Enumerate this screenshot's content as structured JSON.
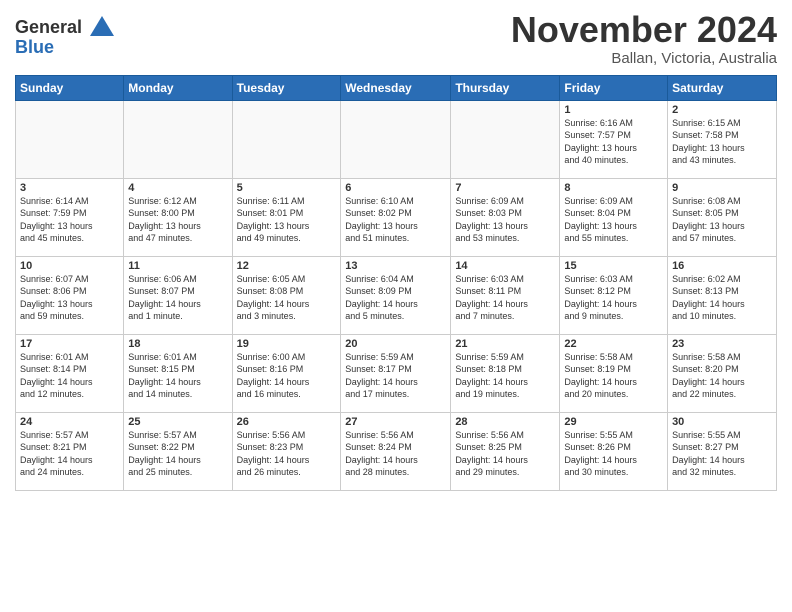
{
  "logo": {
    "line1": "General",
    "line2": "Blue"
  },
  "title": "November 2024",
  "location": "Ballan, Victoria, Australia",
  "days_of_week": [
    "Sunday",
    "Monday",
    "Tuesday",
    "Wednesday",
    "Thursday",
    "Friday",
    "Saturday"
  ],
  "weeks": [
    [
      {
        "day": "",
        "info": ""
      },
      {
        "day": "",
        "info": ""
      },
      {
        "day": "",
        "info": ""
      },
      {
        "day": "",
        "info": ""
      },
      {
        "day": "",
        "info": ""
      },
      {
        "day": "1",
        "info": "Sunrise: 6:16 AM\nSunset: 7:57 PM\nDaylight: 13 hours\nand 40 minutes."
      },
      {
        "day": "2",
        "info": "Sunrise: 6:15 AM\nSunset: 7:58 PM\nDaylight: 13 hours\nand 43 minutes."
      }
    ],
    [
      {
        "day": "3",
        "info": "Sunrise: 6:14 AM\nSunset: 7:59 PM\nDaylight: 13 hours\nand 45 minutes."
      },
      {
        "day": "4",
        "info": "Sunrise: 6:12 AM\nSunset: 8:00 PM\nDaylight: 13 hours\nand 47 minutes."
      },
      {
        "day": "5",
        "info": "Sunrise: 6:11 AM\nSunset: 8:01 PM\nDaylight: 13 hours\nand 49 minutes."
      },
      {
        "day": "6",
        "info": "Sunrise: 6:10 AM\nSunset: 8:02 PM\nDaylight: 13 hours\nand 51 minutes."
      },
      {
        "day": "7",
        "info": "Sunrise: 6:09 AM\nSunset: 8:03 PM\nDaylight: 13 hours\nand 53 minutes."
      },
      {
        "day": "8",
        "info": "Sunrise: 6:09 AM\nSunset: 8:04 PM\nDaylight: 13 hours\nand 55 minutes."
      },
      {
        "day": "9",
        "info": "Sunrise: 6:08 AM\nSunset: 8:05 PM\nDaylight: 13 hours\nand 57 minutes."
      }
    ],
    [
      {
        "day": "10",
        "info": "Sunrise: 6:07 AM\nSunset: 8:06 PM\nDaylight: 13 hours\nand 59 minutes."
      },
      {
        "day": "11",
        "info": "Sunrise: 6:06 AM\nSunset: 8:07 PM\nDaylight: 14 hours\nand 1 minute."
      },
      {
        "day": "12",
        "info": "Sunrise: 6:05 AM\nSunset: 8:08 PM\nDaylight: 14 hours\nand 3 minutes."
      },
      {
        "day": "13",
        "info": "Sunrise: 6:04 AM\nSunset: 8:09 PM\nDaylight: 14 hours\nand 5 minutes."
      },
      {
        "day": "14",
        "info": "Sunrise: 6:03 AM\nSunset: 8:11 PM\nDaylight: 14 hours\nand 7 minutes."
      },
      {
        "day": "15",
        "info": "Sunrise: 6:03 AM\nSunset: 8:12 PM\nDaylight: 14 hours\nand 9 minutes."
      },
      {
        "day": "16",
        "info": "Sunrise: 6:02 AM\nSunset: 8:13 PM\nDaylight: 14 hours\nand 10 minutes."
      }
    ],
    [
      {
        "day": "17",
        "info": "Sunrise: 6:01 AM\nSunset: 8:14 PM\nDaylight: 14 hours\nand 12 minutes."
      },
      {
        "day": "18",
        "info": "Sunrise: 6:01 AM\nSunset: 8:15 PM\nDaylight: 14 hours\nand 14 minutes."
      },
      {
        "day": "19",
        "info": "Sunrise: 6:00 AM\nSunset: 8:16 PM\nDaylight: 14 hours\nand 16 minutes."
      },
      {
        "day": "20",
        "info": "Sunrise: 5:59 AM\nSunset: 8:17 PM\nDaylight: 14 hours\nand 17 minutes."
      },
      {
        "day": "21",
        "info": "Sunrise: 5:59 AM\nSunset: 8:18 PM\nDaylight: 14 hours\nand 19 minutes."
      },
      {
        "day": "22",
        "info": "Sunrise: 5:58 AM\nSunset: 8:19 PM\nDaylight: 14 hours\nand 20 minutes."
      },
      {
        "day": "23",
        "info": "Sunrise: 5:58 AM\nSunset: 8:20 PM\nDaylight: 14 hours\nand 22 minutes."
      }
    ],
    [
      {
        "day": "24",
        "info": "Sunrise: 5:57 AM\nSunset: 8:21 PM\nDaylight: 14 hours\nand 24 minutes."
      },
      {
        "day": "25",
        "info": "Sunrise: 5:57 AM\nSunset: 8:22 PM\nDaylight: 14 hours\nand 25 minutes."
      },
      {
        "day": "26",
        "info": "Sunrise: 5:56 AM\nSunset: 8:23 PM\nDaylight: 14 hours\nand 26 minutes."
      },
      {
        "day": "27",
        "info": "Sunrise: 5:56 AM\nSunset: 8:24 PM\nDaylight: 14 hours\nand 28 minutes."
      },
      {
        "day": "28",
        "info": "Sunrise: 5:56 AM\nSunset: 8:25 PM\nDaylight: 14 hours\nand 29 minutes."
      },
      {
        "day": "29",
        "info": "Sunrise: 5:55 AM\nSunset: 8:26 PM\nDaylight: 14 hours\nand 30 minutes."
      },
      {
        "day": "30",
        "info": "Sunrise: 5:55 AM\nSunset: 8:27 PM\nDaylight: 14 hours\nand 32 minutes."
      }
    ]
  ]
}
